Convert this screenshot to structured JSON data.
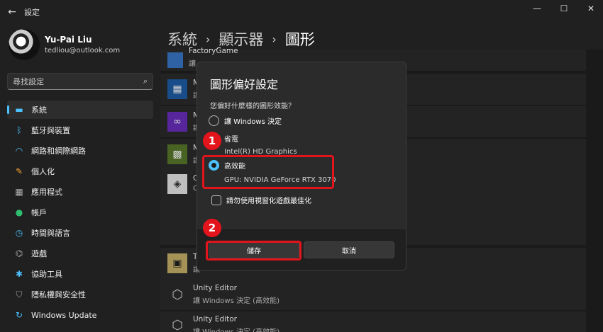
{
  "window": {
    "title": "設定",
    "controls": {
      "minimize": "—",
      "maximize": "☐",
      "close": "✕"
    }
  },
  "user": {
    "name": "Yu-Pai Liu",
    "email": "tedliou@outlook.com"
  },
  "search": {
    "placeholder": "尋找設定"
  },
  "sidebar": {
    "items": [
      {
        "label": "系統",
        "icon": "display-icon",
        "glyph": "▬",
        "color": "#4cc2ff",
        "active": true
      },
      {
        "label": "藍牙與裝置",
        "icon": "bluetooth-icon",
        "glyph": "ᛒ",
        "color": "#4cc2ff",
        "active": false
      },
      {
        "label": "網路和網際網路",
        "icon": "wifi-icon",
        "glyph": "◠",
        "color": "#4cc2ff",
        "active": false
      },
      {
        "label": "個人化",
        "icon": "brush-icon",
        "glyph": "✎",
        "color": "#f0a030",
        "active": false
      },
      {
        "label": "應用程式",
        "icon": "apps-icon",
        "glyph": "▦",
        "color": "#b0b0b0",
        "active": false
      },
      {
        "label": "帳戶",
        "icon": "account-icon",
        "glyph": "●",
        "color": "#2fbf71",
        "active": false
      },
      {
        "label": "時間與語言",
        "icon": "globe-clock-icon",
        "glyph": "◷",
        "color": "#4cc2ff",
        "active": false
      },
      {
        "label": "遊戲",
        "icon": "gamepad-icon",
        "glyph": "⌬",
        "color": "#b0b0b0",
        "active": false
      },
      {
        "label": "協助工具",
        "icon": "accessibility-icon",
        "glyph": "✱",
        "color": "#4cc2ff",
        "active": false
      },
      {
        "label": "隱私權與安全性",
        "icon": "shield-icon",
        "glyph": "⛉",
        "color": "#9a9a9a",
        "active": false
      },
      {
        "label": "Windows Update",
        "icon": "update-icon",
        "glyph": "↻",
        "color": "#4cc2ff",
        "active": false
      }
    ]
  },
  "breadcrumb": {
    "items": [
      "系統",
      "顯示器",
      "圖形"
    ],
    "separator": "›"
  },
  "app_list": {
    "partial_items": [
      {
        "name": "FactoryGame",
        "pref": "讓"
      },
      {
        "name": "M",
        "pref": "讓"
      },
      {
        "name": "M",
        "pref": "讓"
      },
      {
        "name": "M",
        "pref": "讓"
      },
      {
        "name": "C",
        "pref": "C"
      },
      {
        "name": "T",
        "pref": "讓"
      }
    ],
    "items": [
      {
        "name": "Unity Editor",
        "pref": "讓 Windows 決定 (高效能)"
      },
      {
        "name": "Unity Editor",
        "pref": "讓 Windows 決定 (高效能)"
      }
    ]
  },
  "dialog": {
    "title": "圖形偏好設定",
    "question": "您偏好什麼樣的圖形效能？",
    "options": [
      {
        "label": "讓 Windows 決定",
        "sub": "",
        "checked": false
      },
      {
        "label": "省電",
        "sub": "Intel(R) HD Graphics",
        "checked": false
      },
      {
        "label": "高效能",
        "sub": "GPU: NVIDIA GeForce RTX 3070",
        "checked": true
      }
    ],
    "checkbox_label": "請勿使用視窗化遊戲最佳化",
    "save_label": "儲存",
    "cancel_label": "取消"
  },
  "annotations": {
    "badge1": "1",
    "badge2": "2",
    "color": "#e3141b"
  },
  "colors": {
    "accent": "#4cc2ff",
    "background": "#202020"
  }
}
